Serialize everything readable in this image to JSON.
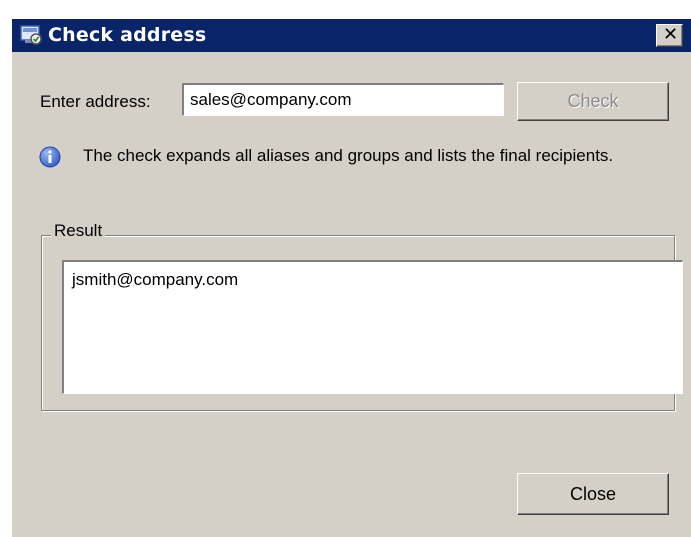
{
  "window": {
    "title": "Check address",
    "close_glyph": "✕"
  },
  "form": {
    "address_label": "Enter address:",
    "address_value": "sales@company.com",
    "check_label": "Check"
  },
  "info": {
    "icon": "info-icon",
    "text": "The check expands all aliases and groups and lists the final recipients."
  },
  "result": {
    "group_label": "Result",
    "lines": [
      "jsmith@company.com"
    ]
  },
  "footer": {
    "close_label": "Close"
  },
  "colors": {
    "titlebar": "#0a246a",
    "dialog_bg": "#d4d0c8",
    "info_icon": "#2b58c8"
  }
}
